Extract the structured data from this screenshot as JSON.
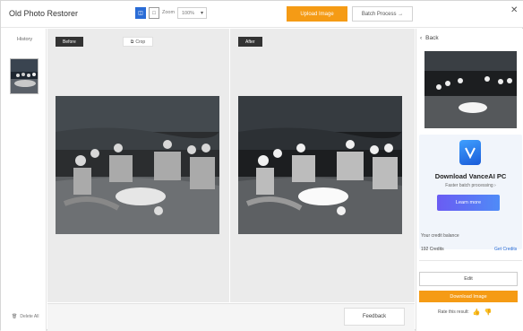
{
  "header": {
    "title": "Old Photo Restorer",
    "view_side_by_side_icon": "◫",
    "view_single_icon": "□",
    "zoom_label": "Zoom",
    "zoom_value": "100%",
    "upload_label": "Upload Image",
    "batch_label": "Batch Process →",
    "close_icon": "✕"
  },
  "left_sidebar": {
    "history_label": "History",
    "delete_all_label": "Delete All"
  },
  "main": {
    "before_label": "Before",
    "crop_label": "Crop",
    "after_label": "After",
    "feedback_label": "Feedback"
  },
  "right_panel": {
    "back_label": "Back",
    "promo_title": "Download VanceAI PC",
    "promo_sub": "Faster batch processing ›",
    "learn_more_label": "Learn more",
    "credits_label": "Your credit balance",
    "credits_count": "192 Credits",
    "get_credits_label": "Get Credits",
    "edit_label": "Edit",
    "download_label": "Download Image",
    "rate_label": "Rate this result:"
  },
  "colors": {
    "accent_orange": "#f59b15",
    "accent_blue": "#2a6cd6"
  }
}
